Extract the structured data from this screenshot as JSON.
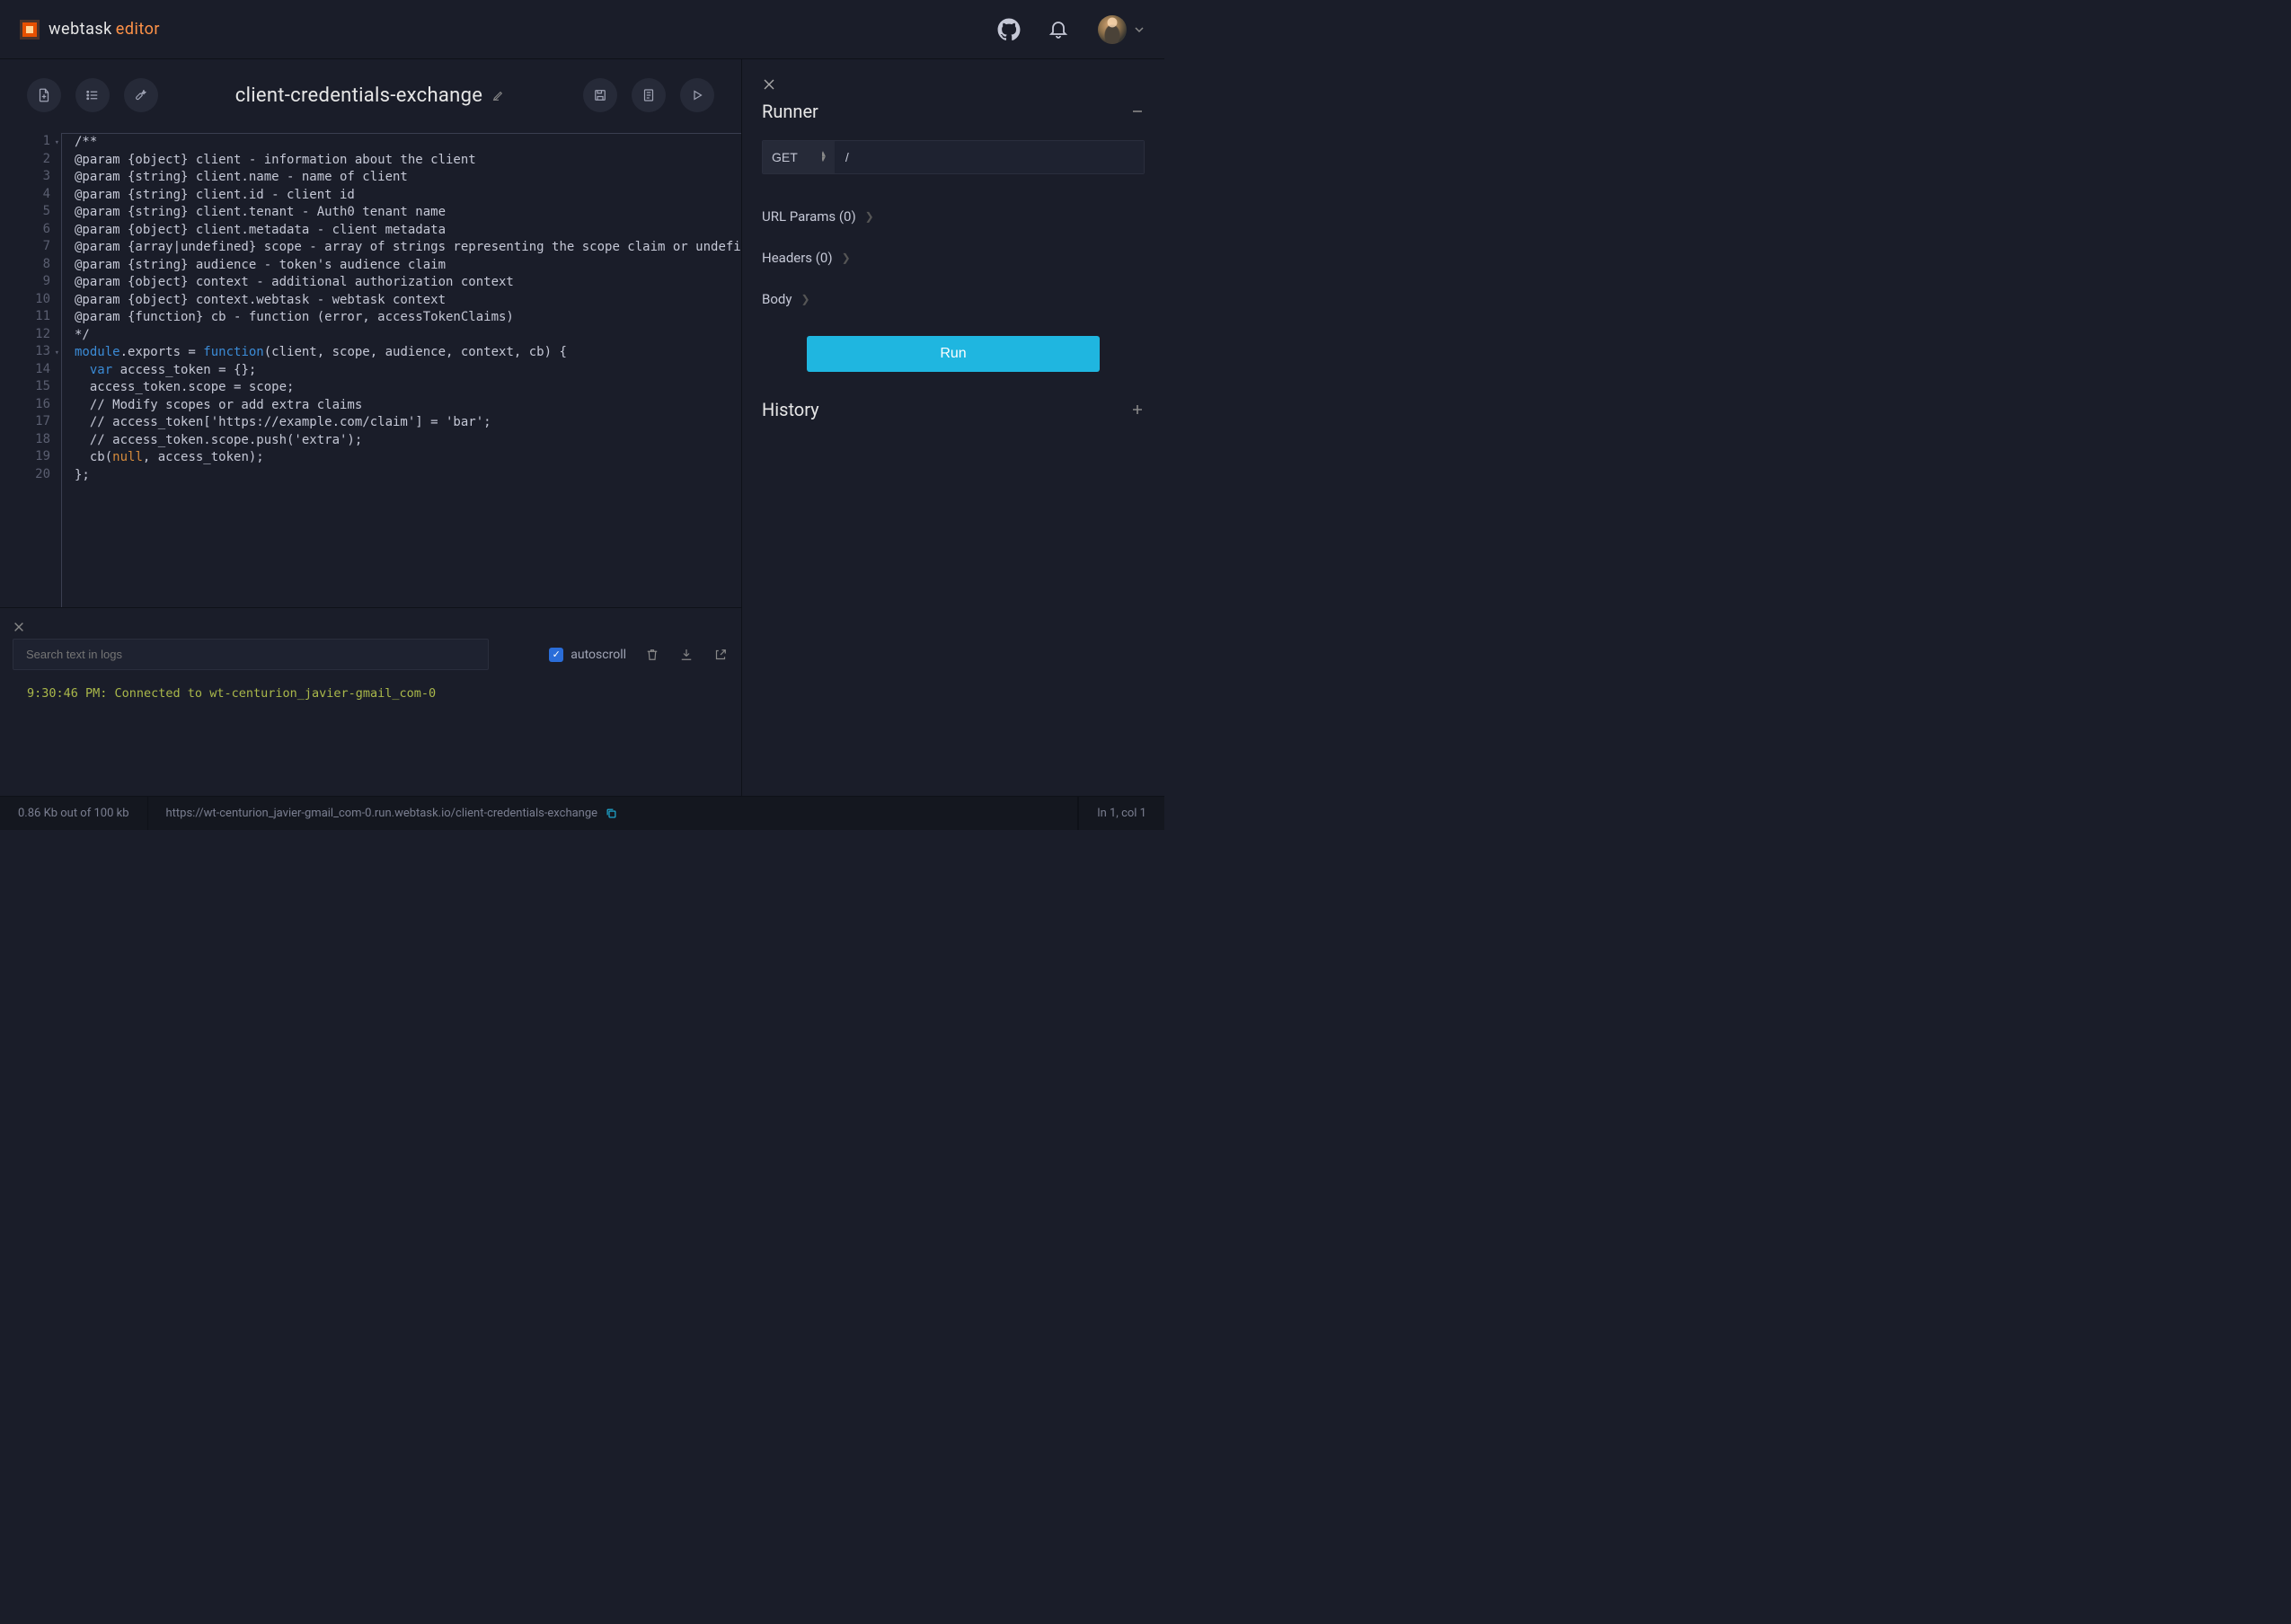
{
  "header": {
    "brand_webtask": "webtask",
    "brand_editor": "editor"
  },
  "toolbar": {
    "title": "client-credentials-exchange"
  },
  "code": {
    "lines": [
      {
        "n": 1,
        "fold": true,
        "html": "/**"
      },
      {
        "n": 2,
        "html": "@param {object} client - information about the client"
      },
      {
        "n": 3,
        "html": "@param {string} client.name - name of client"
      },
      {
        "n": 4,
        "html": "@param {string} client.id - client id"
      },
      {
        "n": 5,
        "html": "@param {string} client.tenant - Auth0 tenant name"
      },
      {
        "n": 6,
        "html": "@param {object} client.metadata - client metadata"
      },
      {
        "n": 7,
        "html": "@param {array|undefined} scope - array of strings representing the scope claim or undefined"
      },
      {
        "n": 8,
        "html": "@param {string} audience - token's audience claim"
      },
      {
        "n": 9,
        "html": "@param {object} context - additional authorization context"
      },
      {
        "n": 10,
        "html": "@param {object} context.webtask - webtask context"
      },
      {
        "n": 11,
        "html": "@param {function} cb - function (error, accessTokenClaims)"
      },
      {
        "n": 12,
        "html": "*/"
      },
      {
        "n": 13,
        "fold": true,
        "html": "<span class=\"tok-keyword\">module</span>.exports = <span class=\"tok-keyword2\">function</span>(client, scope, audience, context, cb) {"
      },
      {
        "n": 14,
        "html": "  <span class=\"tok-var\">var</span> access_token = {};"
      },
      {
        "n": 15,
        "html": "  access_token.scope = scope;"
      },
      {
        "n": 16,
        "html": "  // Modify scopes or add extra claims"
      },
      {
        "n": 17,
        "html": "  // access_token['https://example.com/claim'] = 'bar';"
      },
      {
        "n": 18,
        "html": "  // access_token.scope.push('extra');"
      },
      {
        "n": 19,
        "html": "  cb(<span class=\"tok-null\">null</span>, access_token);"
      },
      {
        "n": 20,
        "html": "};"
      }
    ]
  },
  "logs": {
    "search_placeholder": "Search text in logs",
    "autoscroll_label": "autoscroll",
    "entry": "9:30:46 PM: Connected to wt-centurion_javier-gmail_com-0"
  },
  "runner": {
    "title": "Runner",
    "method": "GET",
    "url_value": "/",
    "url_params_label": "URL Params (0)",
    "headers_label": "Headers (0)",
    "body_label": "Body",
    "run_label": "Run",
    "history_title": "History"
  },
  "status": {
    "size": "0.86 Kb out of 100 kb",
    "url": "https://wt-centurion_javier-gmail_com-0.run.webtask.io/client-credentials-exchange",
    "cursor": "ln 1, col 1"
  }
}
